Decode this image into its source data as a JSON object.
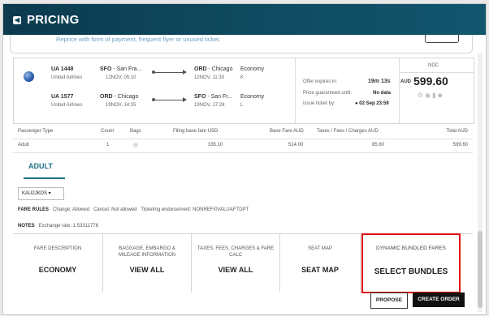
{
  "header": {
    "title": "PRICING"
  },
  "clipped_row": {
    "text": "Reprice with form of payment, frequent flyer or unused ticket."
  },
  "itinerary": [
    {
      "flight": "UA 1448",
      "airline": "United Airlines",
      "from_code": "SFO",
      "from_city": " - San Fra...",
      "dep": "12NOV, 05:10",
      "to_code": "ORD",
      "to_city": " - Chicago",
      "arr": "12NOV, 11:30",
      "cabin": "Economy",
      "class": "K"
    },
    {
      "flight": "UA 1577",
      "airline": "United Airlines",
      "from_code": "ORD",
      "from_city": " - Chicago",
      "dep": "19NOV, 14:35",
      "to_code": "SFO",
      "to_city": " - San Fr...",
      "arr": "19NOV, 17:28",
      "cabin": "Economy",
      "class": "L"
    }
  ],
  "offer": {
    "expires_label": "Offer expires in:",
    "expires_value": "19m 13s",
    "guaranteed_label": "Price guaranteed until:",
    "guaranteed_value": "No data",
    "ticket_label": "Issue ticket by:",
    "ticket_value": "02 Sep 23:59",
    "ndc": "NDC",
    "currency": "AUD",
    "price": "599.60"
  },
  "passenger_table": {
    "headers": [
      "Passenger Type",
      "Count",
      "Bags",
      "Filing base fare USD",
      "Base Fare AUD",
      "Taxes / Fees / Charges AUD",
      "Total AUD"
    ],
    "row": [
      "Adult",
      "1",
      "",
      "335.10",
      "514.00",
      "85.60",
      "599.60"
    ]
  },
  "tabs": {
    "adult": "ADULT"
  },
  "fare_select": {
    "value": "KAU2JKDS ▾"
  },
  "fare_rules": {
    "label": "FARE RULES",
    "change": "Change: Allowed",
    "cancel": "Cancel: Not allowed",
    "endorsement": "Ticketing endorsement: NONREF/0VALUAFTDPT"
  },
  "notes": {
    "label": "NOTES",
    "text": "Exchange rate: 1.53311776"
  },
  "columns": [
    {
      "label": "FARE DESCRIPTION",
      "value": "ECONOMY"
    },
    {
      "label": "BAGGAGE, EMBARGO & MILEAGE INFORMATION",
      "value": "VIEW ALL"
    },
    {
      "label": "TAXES, FEES, CHARGES & FARE CALC",
      "value": "VIEW ALL"
    },
    {
      "label": "SEAT MAP",
      "value": "SEAT MAP"
    },
    {
      "label": "DYNAMIC BUNDLED FARES",
      "value": "SELECT BUNDLES"
    }
  ],
  "actions": {
    "propose": "PROPOSE",
    "create_order": "CREATE ORDER"
  },
  "colors": {
    "header": "#0f4b61",
    "accent": "#1e6e87",
    "highlight": "#dd1111"
  }
}
